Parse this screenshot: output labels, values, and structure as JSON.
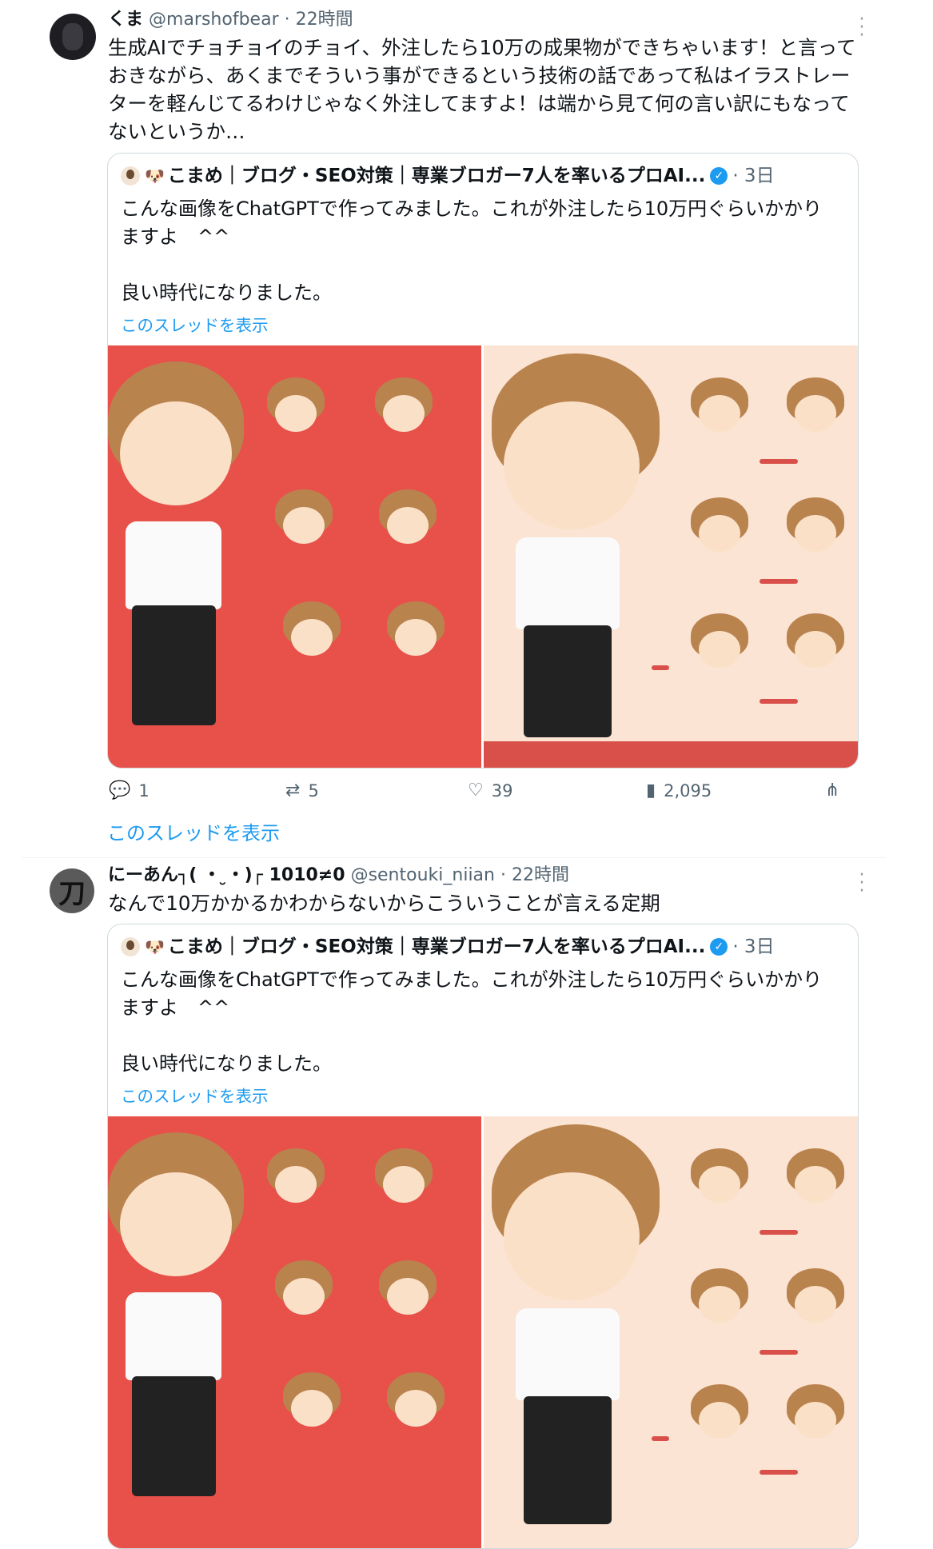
{
  "tweet1": {
    "name": "くま",
    "handle": "@marshofbear",
    "time": "· 22時間",
    "text": "生成AIでチョチョイのチョイ、外注したら10万の成果物ができちゃいます！と言っておきながら、あくまでそういう事ができるという技術の話であって私はイラストレーターを軽んじてるわけじゃなく外注してますよ！は端から見て何の言い訳にもなってないというか…",
    "quote": {
      "name": "こまめ｜ブログ・SEO対策｜専業ブロガー7人を率いるプロAI...",
      "time": "· 3日",
      "text": "こんな画像をChatGPTで作ってみました。これが外注したら10万円ぐらいかかりますよ　^^\n\n良い時代になりました。",
      "show_thread": "このスレッドを表示"
    },
    "actions": {
      "replies": "1",
      "retweets": "5",
      "likes": "39",
      "views": "2,095"
    },
    "show_thread": "このスレッドを表示"
  },
  "tweet2": {
    "name": "にーあん┐( ・ ̮・)┌ 1010≠0",
    "handle": "@sentouki_niian",
    "time": "· 22時間",
    "text": "なんで10万かかるかわからないからこういうことが言える定期",
    "avatar_glyph": "刀",
    "quote": {
      "name": "こまめ｜ブログ・SEO対策｜専業ブロガー7人を率いるプロAI...",
      "time": "· 3日",
      "text": "こんな画像をChatGPTで作ってみました。これが外注したら10万円ぐらいかかりますよ　^^\n\n良い時代になりました。",
      "show_thread": "このスレッドを表示"
    }
  },
  "icons": {
    "more": "more-icon",
    "reply": "reply-icon",
    "retweet": "retweet-icon",
    "like": "heart-icon",
    "views": "views-icon",
    "share": "share-icon",
    "verified": "verified-badge-icon",
    "dog": "dog-emoji-icon"
  },
  "colors": {
    "link": "#1d9bf0",
    "muted": "#536471",
    "img_left_bg": "#e8504a",
    "img_right_bg": "#fbe4d3"
  }
}
